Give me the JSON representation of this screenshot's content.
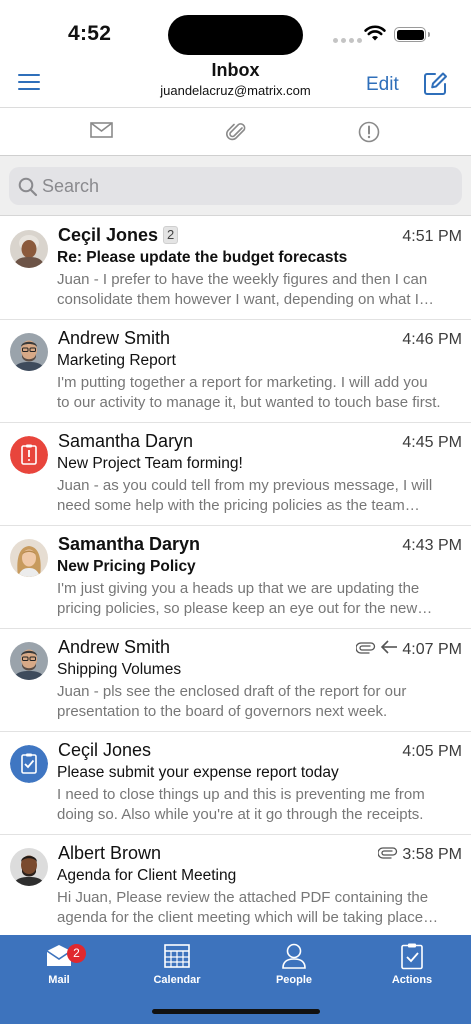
{
  "status_bar": {
    "time": "4:52"
  },
  "header": {
    "title": "Inbox",
    "account": "juandelacruz@matrix.com",
    "edit_label": "Edit"
  },
  "filters": [
    "mail-icon",
    "attachment-icon",
    "important-icon"
  ],
  "search": {
    "placeholder": "Search"
  },
  "messages": [
    {
      "sender": "Ceçil Jones",
      "count": "2",
      "time": "4:51 PM",
      "subject": "Re: Please update the budget forecasts",
      "preview": "Juan - I prefer to have the weekly figures and then I can consolidate them however I want, depending on what I need to report.",
      "unread": true
    },
    {
      "sender": "Andrew Smith",
      "time": "4:46 PM",
      "subject": "Marketing Report",
      "preview": "I'm putting together a report for marketing. I will add you to our activity to manage it, but wanted to touch base first.",
      "unread": false
    },
    {
      "sender": "Samantha Daryn",
      "time": "4:45 PM",
      "subject": "New Project Team forming!",
      "preview": "Juan - as you could tell from my previous message, I will need some help with the pricing policies as the team forms.",
      "unread": false
    },
    {
      "sender": "Samantha Daryn",
      "time": "4:43 PM",
      "subject": "New Pricing Policy",
      "preview": "I'm just giving you a heads up that we are updating the pricing policies, so please keep an eye out for the new version.",
      "unread": true
    },
    {
      "sender": "Andrew Smith",
      "time": "4:07 PM",
      "subject": "Shipping Volumes",
      "preview": "Juan - pls see the enclosed draft of the report for our presentation to the board of governors next week.",
      "unread": false,
      "has_attachment": true,
      "replied": true
    },
    {
      "sender": "Ceçil Jones",
      "time": "4:05 PM",
      "subject": "Please submit your expense report today",
      "preview": "I need to close things up and this is preventing me from doing so. Also while you're at it go through the receipts.",
      "unread": false
    },
    {
      "sender": "Albert Brown",
      "time": "3:58 PM",
      "subject": "Agenda for Client Meeting",
      "preview": "Hi Juan, Please review the attached PDF containing the agenda for the client meeting which will be taking place tomorrow.",
      "unread": false,
      "has_attachment": true
    }
  ],
  "tab_bar": {
    "tabs": [
      {
        "label": "Mail",
        "icon": "mail-icon",
        "badge": "2"
      },
      {
        "label": "Calendar",
        "icon": "calendar-icon"
      },
      {
        "label": "People",
        "icon": "person-icon"
      },
      {
        "label": "Actions",
        "icon": "clipboard-check-icon"
      }
    ]
  },
  "colors": {
    "accent": "#2f6fba",
    "tab_bar": "#3d73bd",
    "badge": "#e0282e",
    "alert_avatar": "#e8453c",
    "task_avatar": "#3f76c2"
  }
}
